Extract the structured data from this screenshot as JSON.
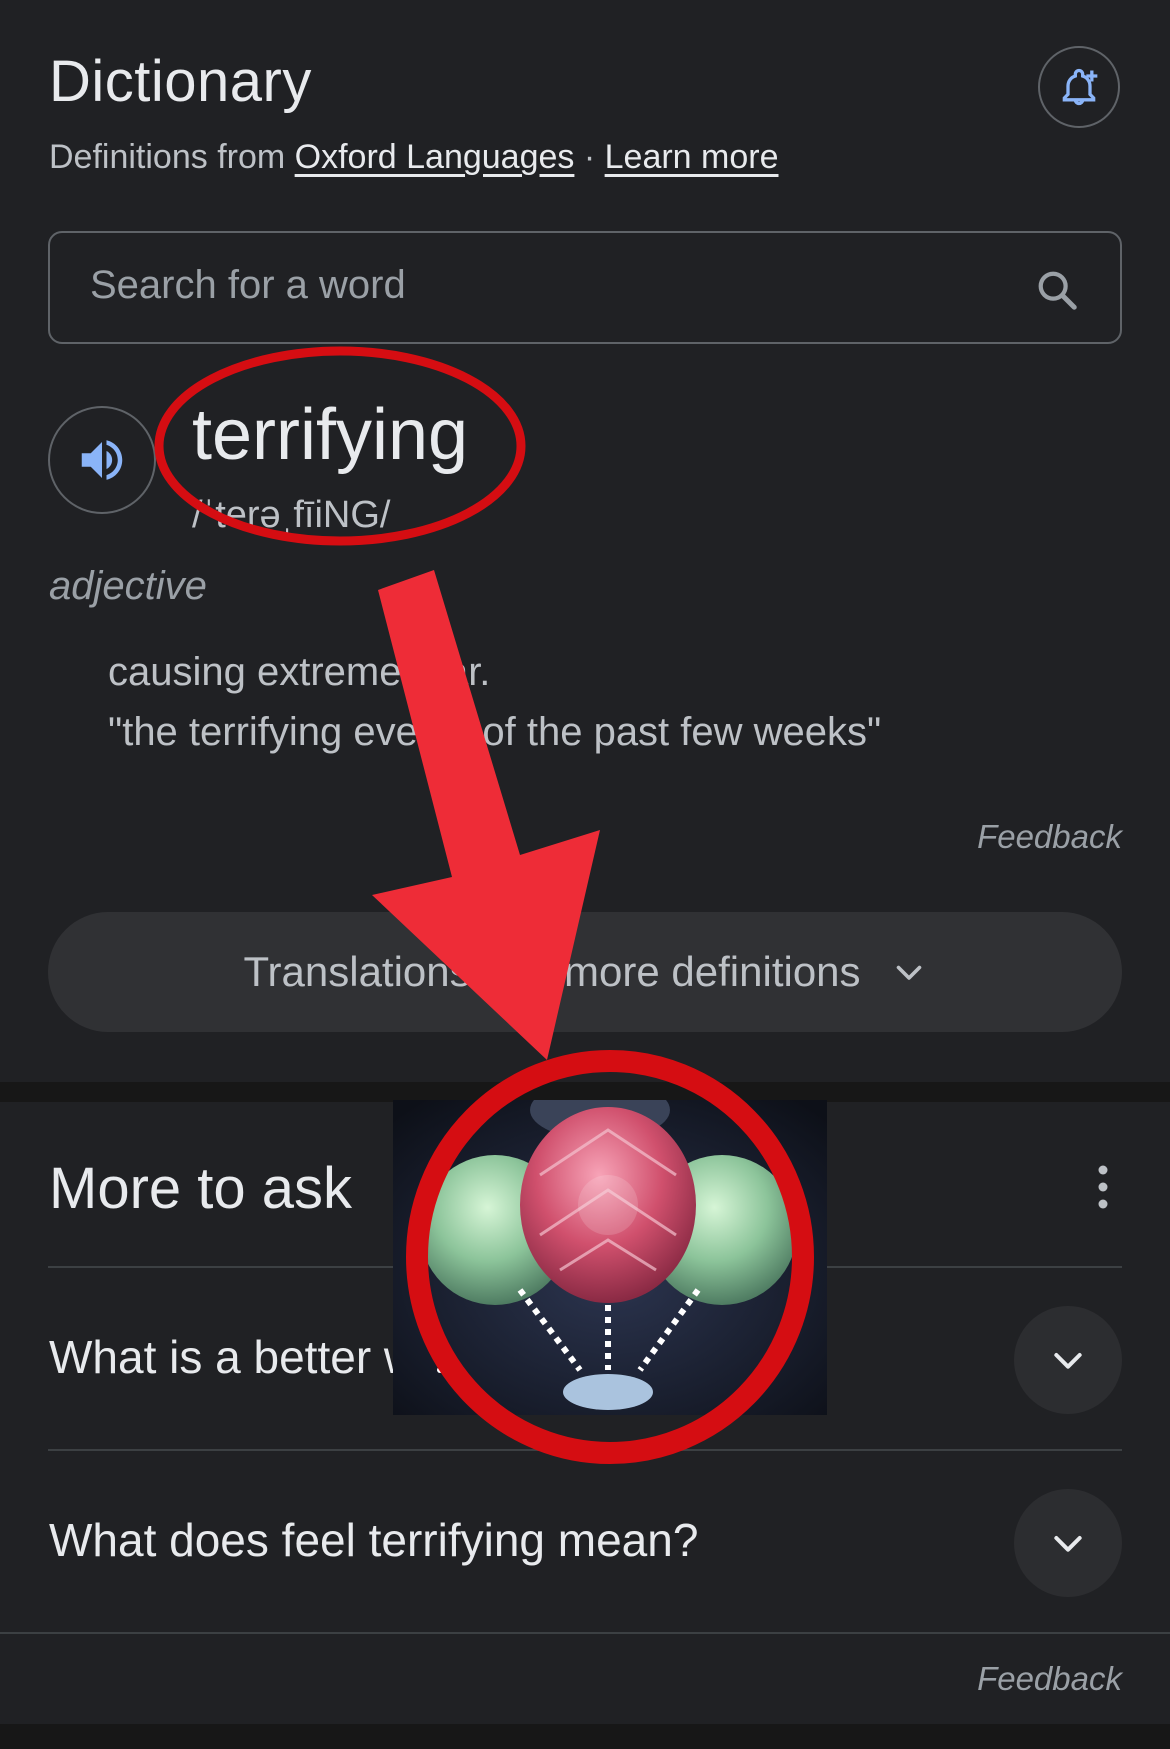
{
  "header": {
    "title": "Dictionary",
    "subtitle_prefix": "Definitions from ",
    "source_link": "Oxford Languages",
    "separator": " · ",
    "learn_more": "Learn more",
    "alert_icon": "bell-plus-icon"
  },
  "search": {
    "placeholder": "Search for a word",
    "icon": "search-icon"
  },
  "entry": {
    "word": "terrifying",
    "phonetic": "/ˈterəˌfīiNG/",
    "part_of_speech": "adjective",
    "definition": "causing extreme fear.",
    "example": "\"the terrifying events of the past few weeks\"",
    "feedback": "Feedback"
  },
  "translations_button": {
    "label": "Translations and more definitions",
    "icon": "chevron-down-icon"
  },
  "more_to_ask": {
    "title": "More to ask",
    "questions": [
      "What is a better word for terrifying?",
      "What does feel terrifying mean?"
    ],
    "feedback": "Feedback"
  },
  "colors": {
    "background": "#202124",
    "annotation_red": "#e3202a",
    "accent_blue": "#8ab4f8"
  }
}
